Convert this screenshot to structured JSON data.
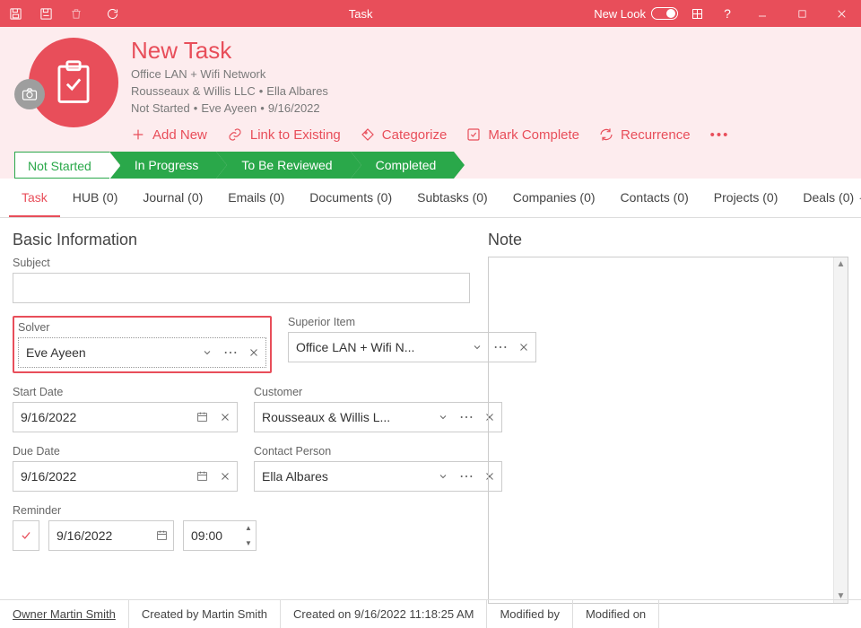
{
  "window": {
    "title": "Task",
    "newLook": "New Look"
  },
  "header": {
    "title": "New Task",
    "meta1": "Office LAN + Wifi Network",
    "meta2a": "Rousseaux & Willis LLC",
    "meta2b": "Ella Albares",
    "meta3a": "Not Started",
    "meta3b": "Eve Ayeen",
    "meta3c": "9/16/2022"
  },
  "actions": {
    "addNew": "Add New",
    "linkExisting": "Link to Existing",
    "categorize": "Categorize",
    "markComplete": "Mark Complete",
    "recurrence": "Recurrence"
  },
  "stages": {
    "s1": "Not Started",
    "s2": "In Progress",
    "s3": "To Be Reviewed",
    "s4": "Completed"
  },
  "tabs": {
    "task": "Task",
    "hub": "HUB (0)",
    "journal": "Journal (0)",
    "emails": "Emails (0)",
    "documents": "Documents (0)",
    "subtasks": "Subtasks (0)",
    "companies": "Companies (0)",
    "contacts": "Contacts (0)",
    "projects": "Projects (0)",
    "deals": "Deals (0)"
  },
  "form": {
    "sectionBasic": "Basic Information",
    "sectionNote": "Note",
    "subjectLabel": "Subject",
    "subjectValue": "",
    "solverLabel": "Solver",
    "solverValue": "Eve Ayeen",
    "superiorLabel": "Superior Item",
    "superiorValue": "Office LAN + Wifi N...",
    "startDateLabel": "Start Date",
    "startDateValue": "9/16/2022",
    "customerLabel": "Customer",
    "customerValue": "Rousseaux & Willis L...",
    "dueDateLabel": "Due Date",
    "dueDateValue": "9/16/2022",
    "contactLabel": "Contact Person",
    "contactValue": "Ella Albares",
    "reminderLabel": "Reminder",
    "reminderDate": "9/16/2022",
    "reminderTime": "09:00"
  },
  "status": {
    "owner": "Owner Martin Smith",
    "createdBy": "Created by Martin Smith",
    "createdOn": "Created on 9/16/2022 11:18:25 AM",
    "modifiedBy": "Modified by",
    "modifiedOn": "Modified on"
  }
}
